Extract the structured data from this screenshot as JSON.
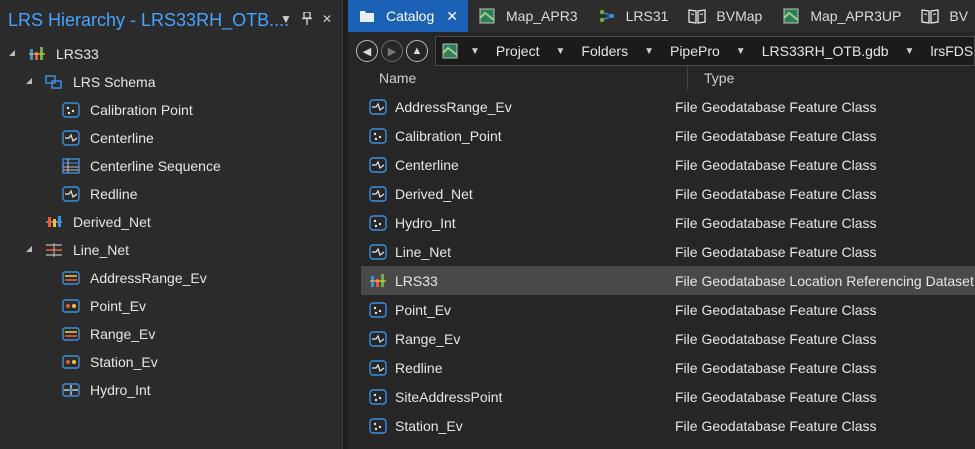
{
  "left_panel": {
    "title": "LRS Hierarchy - LRS33RH_OTB....",
    "header_icons": [
      "chevron-down-icon",
      "pin-icon",
      "close-icon"
    ],
    "tree": [
      {
        "label": "LRS33",
        "icon": "lrs-dataset-icon",
        "level": 0,
        "expander": "▲"
      },
      {
        "label": "LRS Schema",
        "icon": "schema-icon",
        "level": 1,
        "expander": "▲"
      },
      {
        "label": "Calibration Point",
        "icon": "point-feature-class-icon",
        "level": 2,
        "expander": ""
      },
      {
        "label": "Centerline",
        "icon": "line-feature-class-icon",
        "level": 2,
        "expander": ""
      },
      {
        "label": "Centerline Sequence",
        "icon": "table-icon",
        "level": 2,
        "expander": ""
      },
      {
        "label": "Redline",
        "icon": "line-feature-class-icon",
        "level": 2,
        "expander": ""
      },
      {
        "label": "Derived_Net",
        "icon": "derived-network-icon",
        "level": 1,
        "expander": ""
      },
      {
        "label": "Line_Net",
        "icon": "line-network-icon",
        "level": 1,
        "expander": "▲"
      },
      {
        "label": "AddressRange_Ev",
        "icon": "linear-event-icon",
        "level": 2,
        "expander": ""
      },
      {
        "label": "Point_Ev",
        "icon": "point-event-icon",
        "level": 2,
        "expander": ""
      },
      {
        "label": "Range_Ev",
        "icon": "linear-event-icon",
        "level": 2,
        "expander": ""
      },
      {
        "label": "Station_Ev",
        "icon": "point-event-icon",
        "level": 2,
        "expander": ""
      },
      {
        "label": "Hydro_Int",
        "icon": "intersection-icon",
        "level": 2,
        "expander": ""
      }
    ]
  },
  "tabs": [
    {
      "label": "Catalog",
      "icon": "catalog-icon",
      "active": true
    },
    {
      "label": "Map_APR3",
      "icon": "map-icon",
      "active": false
    },
    {
      "label": "LRS31",
      "icon": "diagram-icon",
      "active": false
    },
    {
      "label": "BVMap",
      "icon": "book-icon",
      "active": false
    },
    {
      "label": "Map_APR3UP",
      "icon": "map-icon",
      "active": false
    },
    {
      "label": "BV",
      "icon": "book-icon",
      "active": false
    }
  ],
  "breadcrumb": [
    "Project",
    "Folders",
    "PipePro",
    "LRS33RH_OTB.gdb",
    "lrsFDS"
  ],
  "columns": {
    "name": "Name",
    "type": "Type"
  },
  "items": [
    {
      "name": "AddressRange_Ev",
      "type": "File Geodatabase Feature Class",
      "icon": "line-feature-class-icon"
    },
    {
      "name": "Calibration_Point",
      "type": "File Geodatabase Feature Class",
      "icon": "point-feature-class-icon"
    },
    {
      "name": "Centerline",
      "type": "File Geodatabase Feature Class",
      "icon": "line-feature-class-icon"
    },
    {
      "name": "Derived_Net",
      "type": "File Geodatabase Feature Class",
      "icon": "line-feature-class-icon"
    },
    {
      "name": "Hydro_Int",
      "type": "File Geodatabase Feature Class",
      "icon": "point-feature-class-icon"
    },
    {
      "name": "Line_Net",
      "type": "File Geodatabase Feature Class",
      "icon": "line-feature-class-icon"
    },
    {
      "name": "LRS33",
      "type": "File Geodatabase Location Referencing Dataset",
      "icon": "lrs-dataset-icon",
      "selected": true
    },
    {
      "name": "Point_Ev",
      "type": "File Geodatabase Feature Class",
      "icon": "point-feature-class-icon"
    },
    {
      "name": "Range_Ev",
      "type": "File Geodatabase Feature Class",
      "icon": "line-feature-class-icon"
    },
    {
      "name": "Redline",
      "type": "File Geodatabase Feature Class",
      "icon": "line-feature-class-icon"
    },
    {
      "name": "SiteAddressPoint",
      "type": "File Geodatabase Feature Class",
      "icon": "point-feature-class-icon"
    },
    {
      "name": "Station_Ev",
      "type": "File Geodatabase Feature Class",
      "icon": "point-feature-class-icon"
    }
  ],
  "colors": {
    "accent": "#4aa3ff",
    "active_tab": "#1b62b6",
    "selected_row": "#494949"
  }
}
